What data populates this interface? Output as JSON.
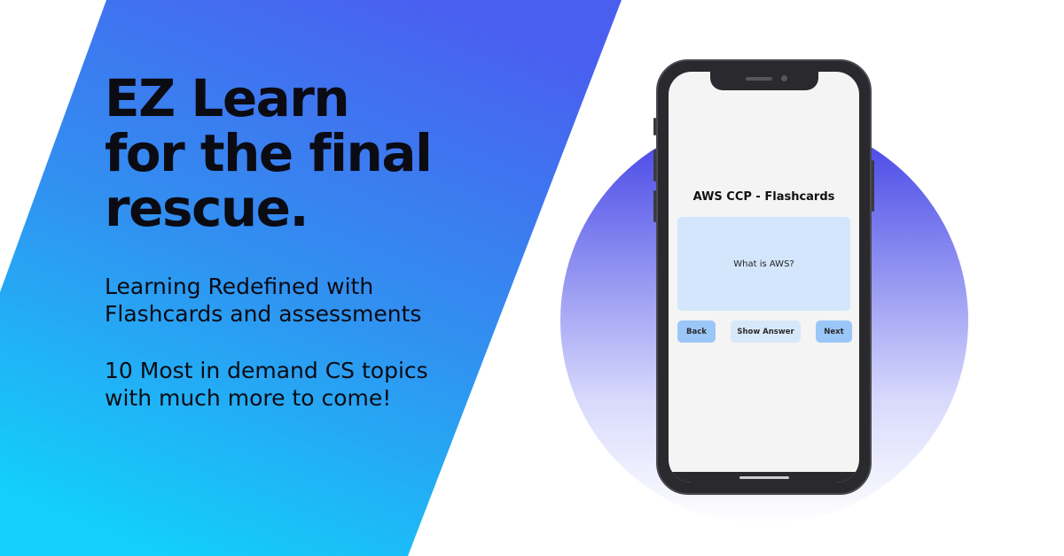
{
  "hero": {
    "headline_lines": [
      "EZ Learn",
      "for the final",
      "rescue."
    ],
    "sub1_lines": [
      "Learning Redefined with",
      "Flashcards and assessments"
    ],
    "sub2_lines": [
      "10 Most in demand CS topics",
      "with much more to come!"
    ]
  },
  "phone_app": {
    "title": "AWS CCP - Flashcards",
    "card_question": "What is AWS?",
    "back_label": "Back",
    "show_answer_label": "Show Answer",
    "next_label": "Next"
  },
  "colors": {
    "banner_top": "#4a5cf0",
    "banner_bottom": "#12d0fb",
    "card": "#d3e6fc",
    "button": "#9bc7f8"
  }
}
